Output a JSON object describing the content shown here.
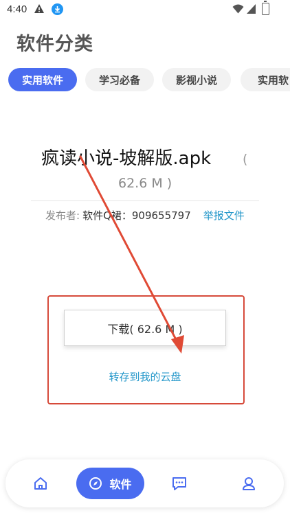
{
  "status_bar": {
    "time": "4:40",
    "icons": [
      "warning-icon",
      "download-icon",
      "wifi-icon",
      "signal-icon",
      "battery-icon"
    ]
  },
  "header": {
    "title": "软件分类"
  },
  "tabs": [
    {
      "label": "实用软件",
      "active": true
    },
    {
      "label": "学习必备",
      "active": false
    },
    {
      "label": "影视小说",
      "active": false
    },
    {
      "label": "实用软",
      "active": false
    }
  ],
  "file": {
    "name": "疯读小说-坡解版.apk",
    "paren_open": "(",
    "size": "62.6 M )",
    "publisher_label": "发布者:",
    "publisher_name": "软件Q裙：909655797",
    "report_label": "举报文件"
  },
  "actions": {
    "download_label": "下载( 62.6 M )",
    "save_cloud_label": "转存到我的云盘"
  },
  "bottom_nav": [
    {
      "icon": "home-icon",
      "label": ""
    },
    {
      "icon": "compass-icon",
      "label": "软件",
      "active": true
    },
    {
      "icon": "chat-icon",
      "label": ""
    },
    {
      "icon": "user-icon",
      "label": ""
    }
  ],
  "colors": {
    "accent": "#4a6cf0",
    "link": "#2196c9",
    "highlight": "#d64a3a"
  }
}
